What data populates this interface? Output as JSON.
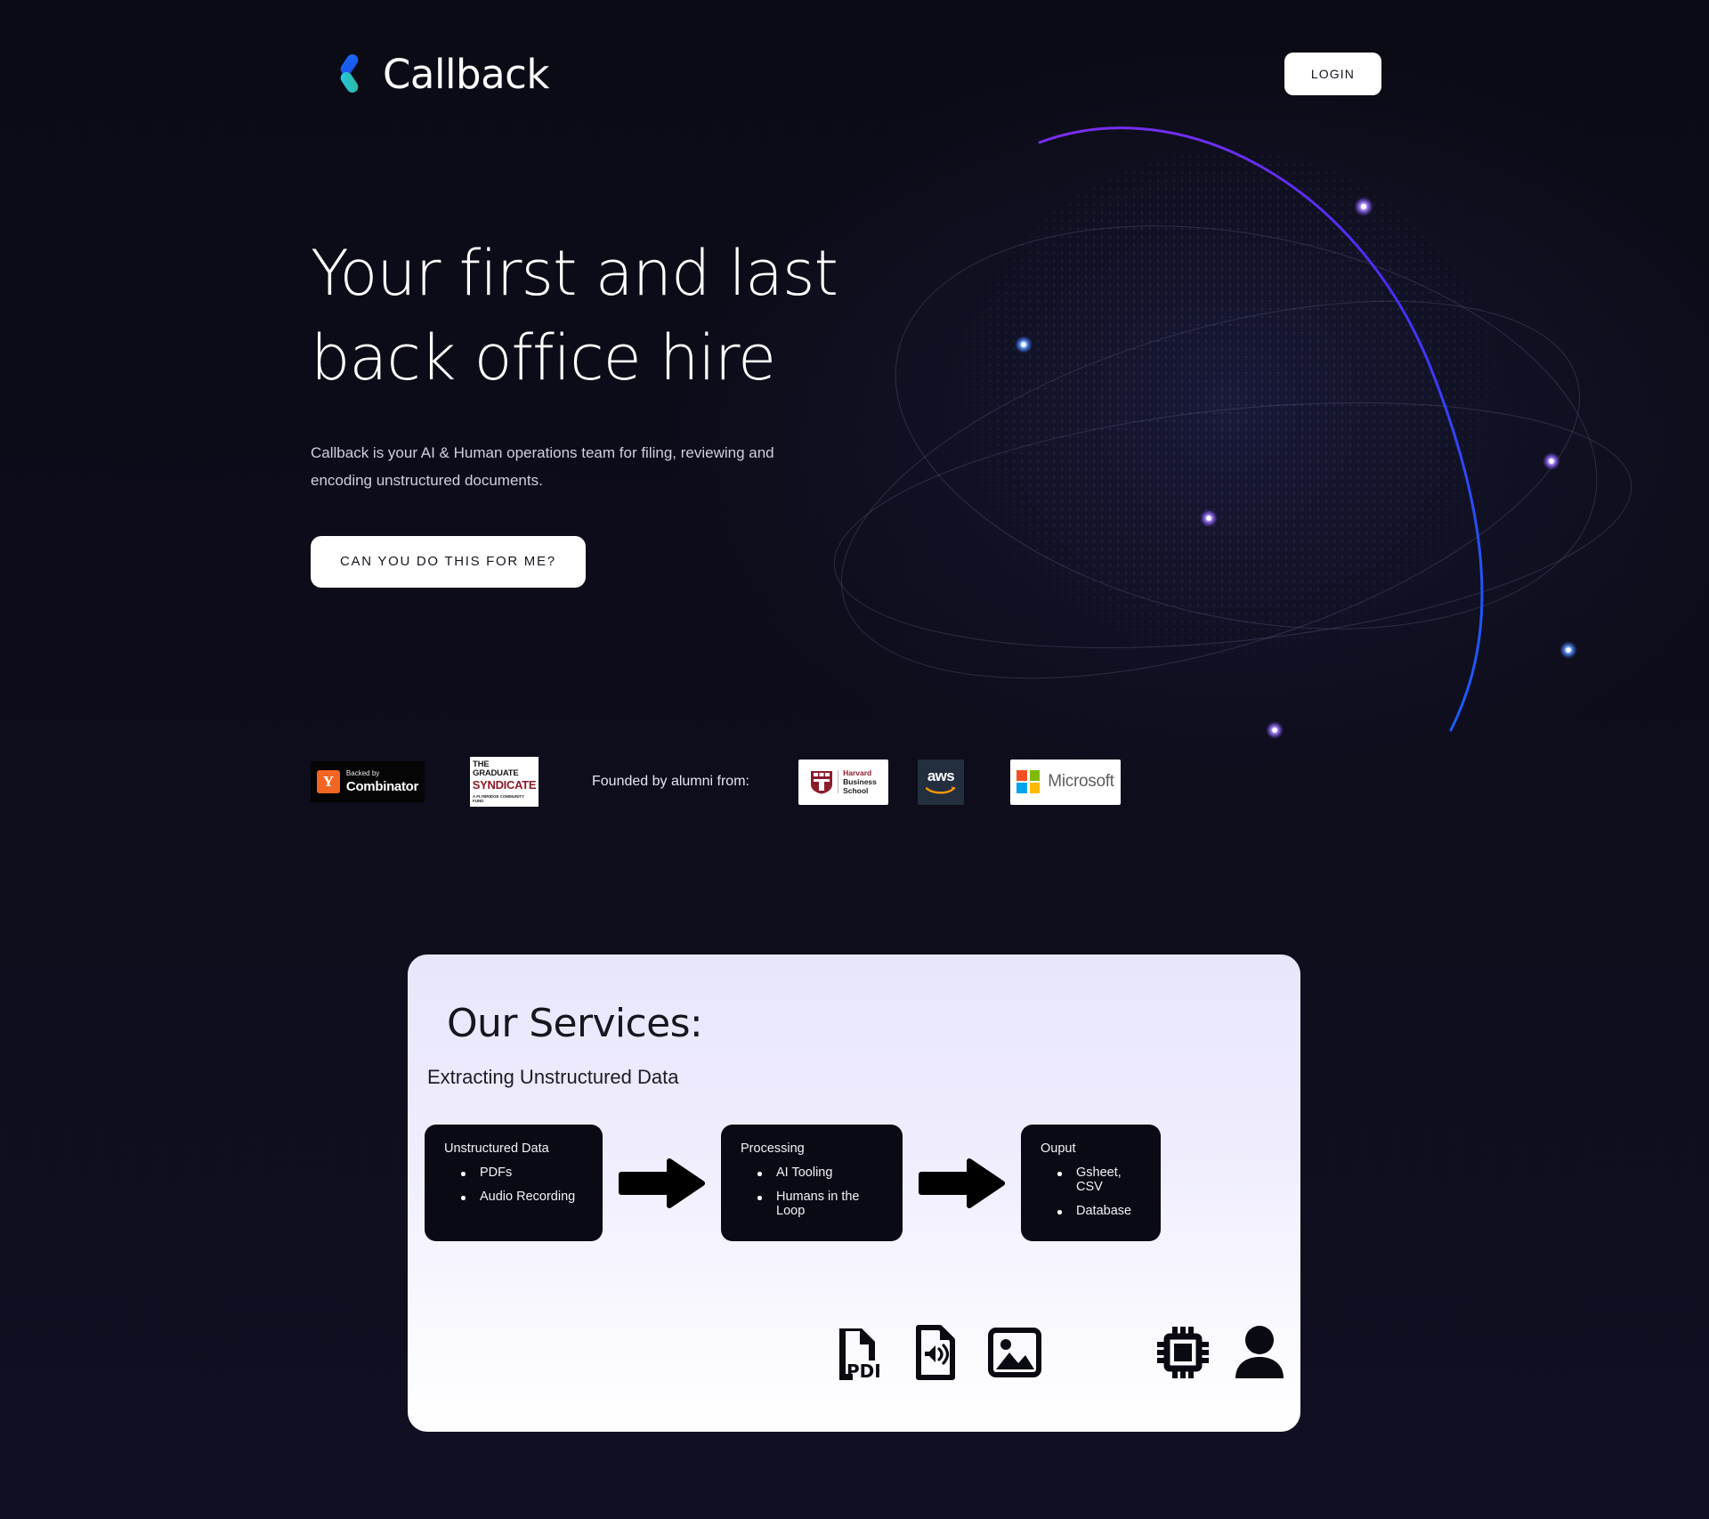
{
  "brand": {
    "name": "Callback",
    "logo_icon": "callback-chevron-logo",
    "colors": {
      "blue": "#1a5cf5",
      "cyan": "#22c5e0",
      "teal": "#2bb79a"
    }
  },
  "header": {
    "login_label": "LOGIN"
  },
  "hero": {
    "headline": "Your first and last back office hire",
    "subhead": "Callback is your AI & Human operations team for filing, reviewing and encoding unstructured documents.",
    "cta_label": "CAN YOU DO THIS FOR ME?"
  },
  "social_proof": {
    "yc": {
      "backed_by": "Backed by",
      "name": "Combinator",
      "mark": "Y"
    },
    "syndicate": {
      "line1": "THE GRADUATE",
      "line2": "SYNDICATE",
      "line3": "A FLYBRIDGE COMMUNITY FUND"
    },
    "founded_label": "Founded by alumni from:",
    "hbs": {
      "line1": "Harvard",
      "line2": "Business",
      "line3": "School"
    },
    "aws": {
      "name": "aws"
    },
    "microsoft": {
      "name": "Microsoft"
    }
  },
  "services": {
    "title": "Our Services:",
    "subtitle": "Extracting Unstructured Data",
    "flow": [
      {
        "title": "Unstructured Data",
        "items": [
          "PDFs",
          "Audio Recording"
        ]
      },
      {
        "title": "Processing",
        "items": [
          "AI Tooling",
          "Humans in the Loop"
        ]
      },
      {
        "title": "Ouput",
        "items": [
          "Gsheet, CSV",
          "Database"
        ]
      }
    ],
    "icons": {
      "input": [
        "pdf-file-icon",
        "audio-file-icon",
        "image-icon"
      ],
      "processing": [
        "cpu-chip-icon",
        "person-icon"
      ],
      "output": [
        "database-icon"
      ]
    }
  },
  "theme": {
    "background": "#0b0b16",
    "card_top": "#e8e6fb",
    "card_bottom": "#ffffff",
    "box_dark": "#0a0a14",
    "accent_purple": "#5b2ee8",
    "accent_blue": "#2447f0"
  }
}
